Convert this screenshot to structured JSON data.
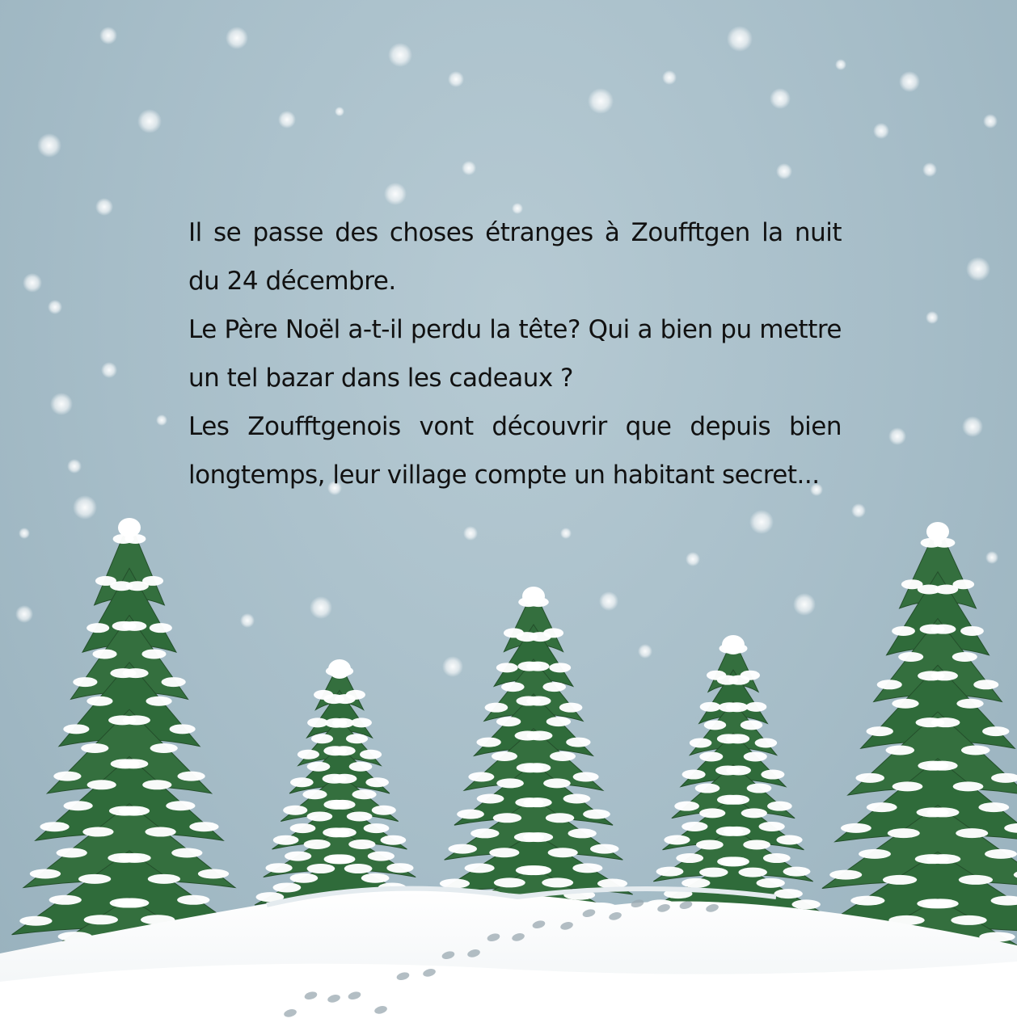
{
  "text": {
    "paragraph_1": "Il se passe des choses étranges à Zoufftgen la nuit du 24 décembre.",
    "paragraph_2": "Le Père Noël a-t-il perdu la tête? Qui a bien pu mettre un tel bazar dans les cadeaux ?",
    "paragraph_3": "Les Zoufftgenois vont découvrir que depuis bien longtemps, leur village compte un habitant secret..."
  },
  "colors": {
    "sky": "#a9c0cb",
    "tree": "#2f6b3a",
    "tree_dark": "#244f2b",
    "snow": "#ffffff",
    "text": "#111111"
  },
  "icons": [
    "snowflake-dot",
    "fir-tree",
    "footprint"
  ]
}
